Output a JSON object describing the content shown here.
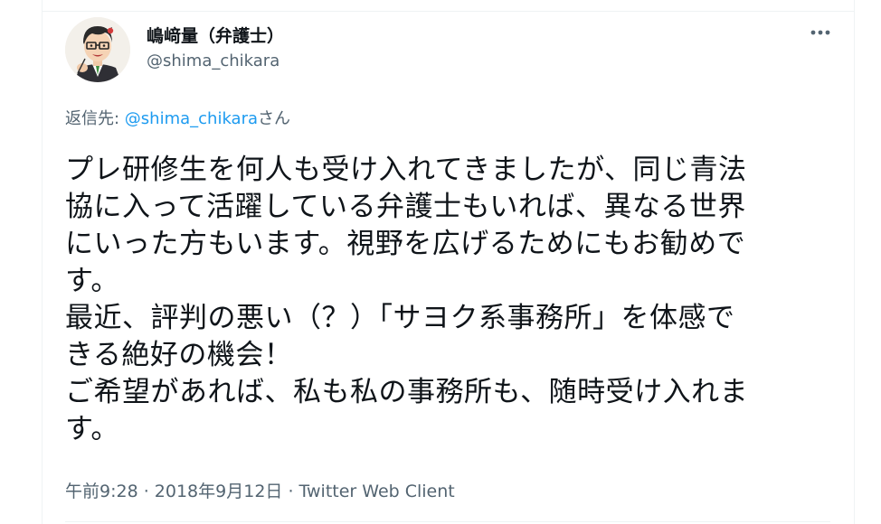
{
  "user": {
    "display_name": "嶋﨑量（弁護士）",
    "handle": "@shima_chikara"
  },
  "reply": {
    "prefix": "返信先: ",
    "mention": "@shima_chikara",
    "suffix": "さん"
  },
  "tweet": {
    "lines": [
      "プレ研修生を何人も受け入れてきましたが、同じ青法",
      "協に入って活躍している弁護士もいれば、異なる世界",
      "にいった方もいます。視野を広げるためにもお勧めで",
      "す。",
      "最近、評判の悪い（？）「サヨク系事務所」を体感で",
      "きる絶好の機会！",
      "ご希望があれば、私も私の事務所も、随時受け入れま",
      "す。"
    ]
  },
  "meta": {
    "time": "午前9:28",
    "separator": " · ",
    "date": "2018年9月12日",
    "client": "Twitter Web Client"
  },
  "icons": {
    "more": "more-horizontal-icon",
    "avatar": "cartoon-portrait-avatar"
  }
}
